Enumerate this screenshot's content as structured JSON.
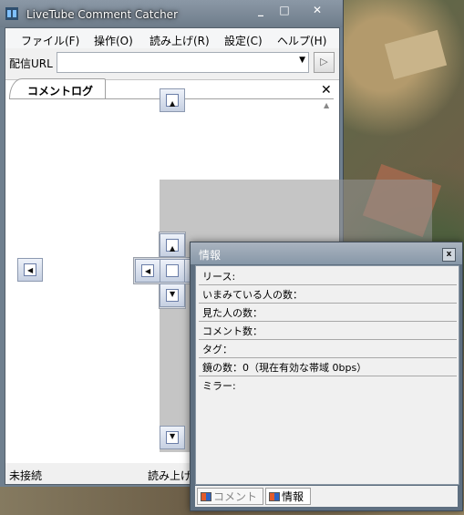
{
  "window": {
    "title": "LiveTube Comment Catcher",
    "minimize": "_",
    "maximize": "□",
    "close": "✕"
  },
  "menu": [
    "ファイル(F)",
    "操作(O)",
    "読み上げ(R)",
    "設定(C)",
    "ヘルプ(H)"
  ],
  "url_bar": {
    "label": "配信URL",
    "value": "",
    "play_glyph": "▷"
  },
  "comment_tab": {
    "label": "コメントログ",
    "close": "✕"
  },
  "status": {
    "connection": "未接続",
    "reading": "読み上げ"
  },
  "info_panel": {
    "title": "情報",
    "close": "x",
    "rows": [
      "リース:",
      "いまみている人の数：",
      "見た人の数：",
      "コメント数：",
      "タグ：",
      "鏡の数：0（現在有効な帯域 0bps）",
      "ミラー:"
    ],
    "tabs": [
      {
        "label": "コメント",
        "icon": "tab-window-icon",
        "active": false
      },
      {
        "label": "情報",
        "icon": "tab-window-icon",
        "active": true
      }
    ]
  },
  "dock_guides": {
    "arrow_up": "▲",
    "arrow_down": "▼",
    "arrow_left": "◀",
    "arrow_right": "▶"
  },
  "colors": {
    "titlebar": "#7a8896",
    "dock_preview": "#969696",
    "status_bg": "#f0f0f0"
  }
}
